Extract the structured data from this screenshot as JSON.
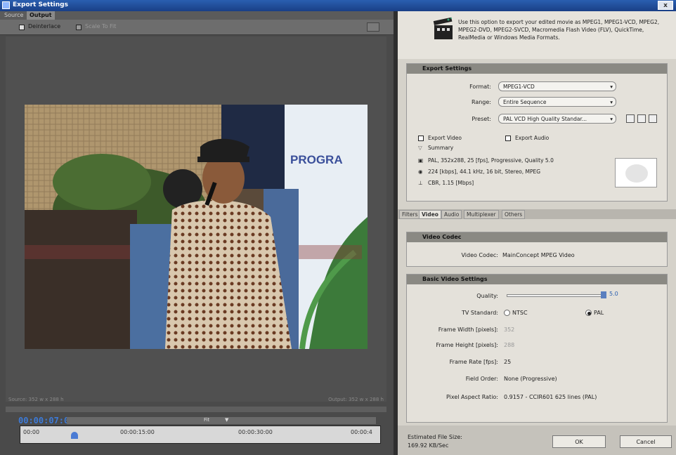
{
  "window": {
    "title": "Export Settings",
    "close": "x"
  },
  "tabs": [
    {
      "label": "Source"
    },
    {
      "label": "Output"
    }
  ],
  "toolbar": {
    "deinterlace": "Deinterlace",
    "scale_to_fit": "Scale To Fit"
  },
  "viewer": {
    "video_caption": "PROGRA",
    "source_info": "Source: 352 w x 288 h",
    "output_info": "Output: 352 w x 288 h"
  },
  "timeline": {
    "timecode": "00:00:07:05",
    "fit": "Fit",
    "ticks": [
      "00:00",
      "00:00:15:00",
      "00:00:30:00",
      "00:00:4"
    ]
  },
  "description": "Use this option to export your edited movie as MPEG1, MPEG1-VCD, MPEG2, MPEG2-DVD, MPEG2-SVCD, Macromedia Flash Video (FLV), QuickTime, RealMedia or Windows Media Formats.",
  "export_settings": {
    "header": "Export Settings",
    "format_label": "Format:",
    "format_value": "MPEG1-VCD",
    "range_label": "Range:",
    "range_value": "Entire Sequence",
    "preset_label": "Preset:",
    "preset_value": "PAL VCD High Quality Standar...",
    "export_video": "Export Video",
    "export_audio": "Export Audio",
    "summary": "Summary",
    "summary_video": "PAL, 352x288, 25 [fps], Progressive, Quality 5.0",
    "summary_audio": "224 [kbps], 44.1 kHz, 16 bit, Stereo, MPEG",
    "summary_bitrate": "CBR, 1.15 [Mbps]"
  },
  "settings_tabs": [
    {
      "label": "Filters"
    },
    {
      "label": "Video"
    },
    {
      "label": "Audio"
    },
    {
      "label": "Multiplexer"
    },
    {
      "label": "Others"
    }
  ],
  "video_codec": {
    "header": "Video Codec",
    "label": "Video Codec:",
    "value": "MainConcept MPEG Video"
  },
  "basic": {
    "header": "Basic Video Settings",
    "quality_label": "Quality:",
    "quality_value": "5.0",
    "tv_label": "TV Standard:",
    "ntsc": "NTSC",
    "pal": "PAL",
    "fw_label": "Frame Width [pixels]:",
    "fw_value": "352",
    "fh_label": "Frame Height [pixels]:",
    "fh_value": "288",
    "fr_label": "Frame Rate [fps]:",
    "fr_value": "25",
    "fo_label": "Field Order:",
    "fo_value": "None (Progressive)",
    "par_label": "Pixel Aspect Ratio:",
    "par_value": "0.9157 - CCIR601 625 lines (PAL)"
  },
  "footer": {
    "size_label": "Estimated File Size:",
    "size_value": "169.92 KB/Sec",
    "ok": "OK",
    "cancel": "Cancel"
  }
}
